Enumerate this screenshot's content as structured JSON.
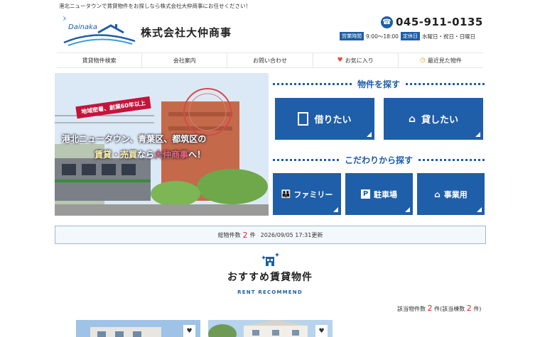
{
  "header": {
    "tagline": "港北ニュータウンで賃貸物件をお探しなら株式会社大仲商事にお任せください！",
    "logo_word": "Dainaka",
    "company_name": "株式会社大仲商事",
    "phone": "045-911-0135",
    "hours_label": "営業時間",
    "hours_value": "9:00～18:00",
    "closed_label": "定休日",
    "closed_value": "水曜日・祝日・日曜日"
  },
  "nav": {
    "items": [
      {
        "label": "賃貸物件検索"
      },
      {
        "label": "会社案内"
      },
      {
        "label": "お問い合わせ"
      },
      {
        "label": "お気に入り"
      },
      {
        "label": "最近見た物件"
      }
    ]
  },
  "hero": {
    "badge": "地域密着、創業60年以上",
    "line1": "港北ニュータウン、青葉区、都筑区の",
    "line2_a": "賃貸・売買",
    "line2_b": "なら",
    "line2_c": "大仲商事",
    "line2_d": "へ！"
  },
  "search": {
    "heading": "物件を探す",
    "rent": "借りたい",
    "lend": "貸したい",
    "heading2": "こだわりから探す",
    "family": "ファミリー",
    "parking": "駐車場",
    "business": "事業用"
  },
  "count": {
    "prefix": "総物件数",
    "num": "2",
    "suffix": "件",
    "updated": "2026/09/05 17:31更新"
  },
  "recommend": {
    "title": "おすすめ賃貸物件",
    "subtitle": "RENT RECOMMEND",
    "result_prefix": "該当物件数",
    "result_num": "2",
    "result_mid": "件(該当棟数",
    "result_num2": "2",
    "result_suffix": "件)"
  },
  "colors": {
    "brand": "#1f5ea8",
    "accent_red": "#e3242b"
  }
}
